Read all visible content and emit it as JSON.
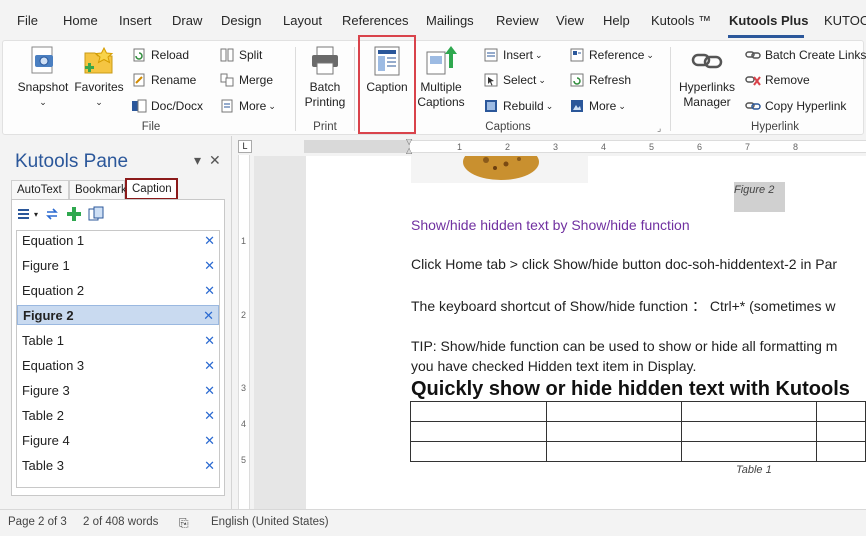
{
  "menu": {
    "items": [
      "File",
      "Home",
      "Insert",
      "Draw",
      "Design",
      "Layout",
      "References",
      "Mailings",
      "Review",
      "View",
      "Help",
      "Kutools ™",
      "Kutools Plus",
      "KUTOO"
    ],
    "active": "Kutools Plus"
  },
  "ribbon": {
    "file_group": {
      "label": "File",
      "snapshot": "Snapshot",
      "favorites": "Favorites",
      "reload": "Reload",
      "rename": "Rename",
      "doc_docx": "Doc/Docx",
      "split": "Split",
      "merge": "Merge",
      "more": "More"
    },
    "print_group": {
      "label": "Print",
      "batch_printing_1": "Batch",
      "batch_printing_2": "Printing"
    },
    "captions_group": {
      "label": "Captions",
      "caption": "Caption",
      "multiple_captions_1": "Multiple",
      "multiple_captions_2": "Captions",
      "insert": "Insert",
      "select": "Select",
      "rebuild": "Rebuild",
      "reference": "Reference",
      "refresh": "Refresh",
      "more": "More"
    },
    "hyperlink_group": {
      "label": "Hyperlink",
      "manager_1": "Hyperlinks",
      "manager_2": "Manager",
      "batch_create": "Batch Create Links",
      "remove": "Remove",
      "copy": "Copy Hyperlink"
    }
  },
  "pane": {
    "title": "Kutools Pane",
    "tabs": [
      "AutoText",
      "Bookmark",
      "Caption"
    ],
    "selected_tab": "Caption",
    "items": [
      "Equation 1",
      "Figure 1",
      "Equation 2",
      "Figure 2",
      "Table 1",
      "Equation 3",
      "Figure 3",
      "Table 2",
      "Figure 4",
      "Table 3"
    ],
    "selected_item": "Figure 2"
  },
  "ruler": {
    "h_numbers": [
      "1",
      "2",
      "3",
      "4",
      "5",
      "6",
      "7",
      "8"
    ],
    "v_numbers": [
      "1",
      "2",
      "3",
      "4",
      "5"
    ]
  },
  "document": {
    "figure_label": "Figure 2",
    "link_line": "Show/hide hidden text by Show/hide function",
    "line1": "Click Home tab > click Show/hide button doc-soh-hiddentext-2 in Par",
    "line2": "The keyboard shortcut of Show/hide function ： Ctrl+* (sometimes w",
    "line3": "TIP: Show/hide function can be used to show or hide all formatting m",
    "line4": "you have checked Hidden text item in Display.",
    "heading": "Quickly show or hide hidden text with Kutools",
    "table_caption": "Table 1"
  },
  "status": {
    "page": "Page 2 of 3",
    "words": "2 of 408 words",
    "language": "English (United States)"
  },
  "colors": {
    "accent": "#2b579a",
    "highlight_border": "#d9434b",
    "purple_link": "#7030a0",
    "remove_x": "#2b6ad1"
  }
}
